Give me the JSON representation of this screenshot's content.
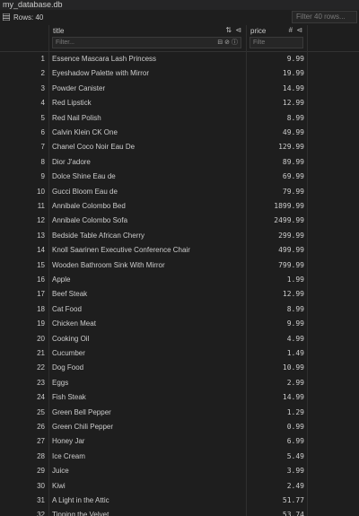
{
  "window": {
    "title": "my_database.db"
  },
  "toolbar": {
    "rows_label": "Rows: 40",
    "filter_placeholder": "Filter 40 rows..."
  },
  "columns": {
    "title": {
      "name": "title",
      "filter_placeholder": "Filter..."
    },
    "price": {
      "name": "price",
      "filter_placeholder": "Filte"
    }
  },
  "icons": {
    "sort": "sort-icon",
    "pin": "pin-icon",
    "type_hash": "hash-icon",
    "filter_mode": "filter-mode-icon",
    "null_filter": "null-filter-icon",
    "info": "info-icon"
  },
  "rows": [
    {
      "n": "1",
      "title": "Essence Mascara Lash Princess",
      "price": "9.99"
    },
    {
      "n": "2",
      "title": "Eyeshadow Palette with Mirror",
      "price": "19.99"
    },
    {
      "n": "3",
      "title": "Powder Canister",
      "price": "14.99"
    },
    {
      "n": "4",
      "title": "Red Lipstick",
      "price": "12.99"
    },
    {
      "n": "5",
      "title": "Red Nail Polish",
      "price": "8.99"
    },
    {
      "n": "6",
      "title": "Calvin Klein CK One",
      "price": "49.99"
    },
    {
      "n": "7",
      "title": "Chanel Coco Noir Eau De",
      "price": "129.99"
    },
    {
      "n": "8",
      "title": "Dior J'adore",
      "price": "89.99"
    },
    {
      "n": "9",
      "title": "Dolce Shine Eau de",
      "price": "69.99"
    },
    {
      "n": "10",
      "title": "Gucci Bloom Eau de",
      "price": "79.99"
    },
    {
      "n": "11",
      "title": "Annibale Colombo Bed",
      "price": "1899.99"
    },
    {
      "n": "12",
      "title": "Annibale Colombo Sofa",
      "price": "2499.99"
    },
    {
      "n": "13",
      "title": "Bedside Table African Cherry",
      "price": "299.99"
    },
    {
      "n": "14",
      "title": "Knoll Saarinen Executive Conference Chair",
      "price": "499.99"
    },
    {
      "n": "15",
      "title": "Wooden Bathroom Sink With Mirror",
      "price": "799.99"
    },
    {
      "n": "16",
      "title": "Apple",
      "price": "1.99"
    },
    {
      "n": "17",
      "title": "Beef Steak",
      "price": "12.99"
    },
    {
      "n": "18",
      "title": "Cat Food",
      "price": "8.99"
    },
    {
      "n": "19",
      "title": "Chicken Meat",
      "price": "9.99"
    },
    {
      "n": "20",
      "title": "Cooking Oil",
      "price": "4.99"
    },
    {
      "n": "21",
      "title": "Cucumber",
      "price": "1.49"
    },
    {
      "n": "22",
      "title": "Dog Food",
      "price": "10.99"
    },
    {
      "n": "23",
      "title": "Eggs",
      "price": "2.99"
    },
    {
      "n": "24",
      "title": "Fish Steak",
      "price": "14.99"
    },
    {
      "n": "25",
      "title": "Green Bell Pepper",
      "price": "1.29"
    },
    {
      "n": "26",
      "title": "Green Chili Pepper",
      "price": "0.99"
    },
    {
      "n": "27",
      "title": "Honey Jar",
      "price": "6.99"
    },
    {
      "n": "28",
      "title": "Ice Cream",
      "price": "5.49"
    },
    {
      "n": "29",
      "title": "Juice",
      "price": "3.99"
    },
    {
      "n": "30",
      "title": "Kiwi",
      "price": "2.49"
    },
    {
      "n": "31",
      "title": "A Light in the Attic",
      "price": "51.77"
    },
    {
      "n": "32",
      "title": "Tipping the Velvet",
      "price": "53.74"
    }
  ],
  "colors": {
    "background": "#1e1e1e",
    "text": "#cccccc",
    "border": "#3a3a3a"
  }
}
